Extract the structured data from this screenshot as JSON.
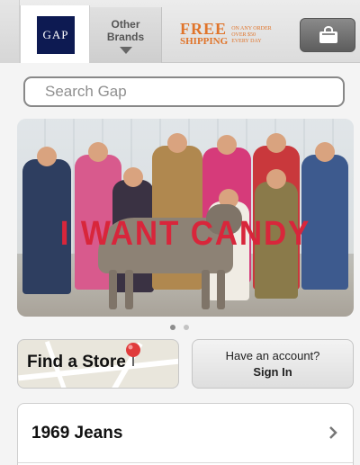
{
  "header": {
    "logo_text": "GAP",
    "other_brands_line1": "Other",
    "other_brands_line2": "Brands",
    "promo_free": "FREE",
    "promo_shipping": "SHIPPING",
    "promo_terms_line1": "ON ANY ORDER",
    "promo_terms_line2": "OVER $50",
    "promo_terms_line3": "EVERY DAY",
    "promo_color": "#e0742a",
    "bag_icon": "shopping-bag-icon"
  },
  "search": {
    "placeholder": "Search Gap"
  },
  "hero": {
    "headline": "I WANT CANDY",
    "headline_color": "#d8263b",
    "slide_count": 2,
    "active_slide": 1
  },
  "actions": {
    "find_store_label": "Find a Store",
    "account_question": "Have an account?",
    "sign_in_label": "Sign In"
  },
  "menu": {
    "items": [
      {
        "label": "1969 Jeans"
      }
    ]
  }
}
